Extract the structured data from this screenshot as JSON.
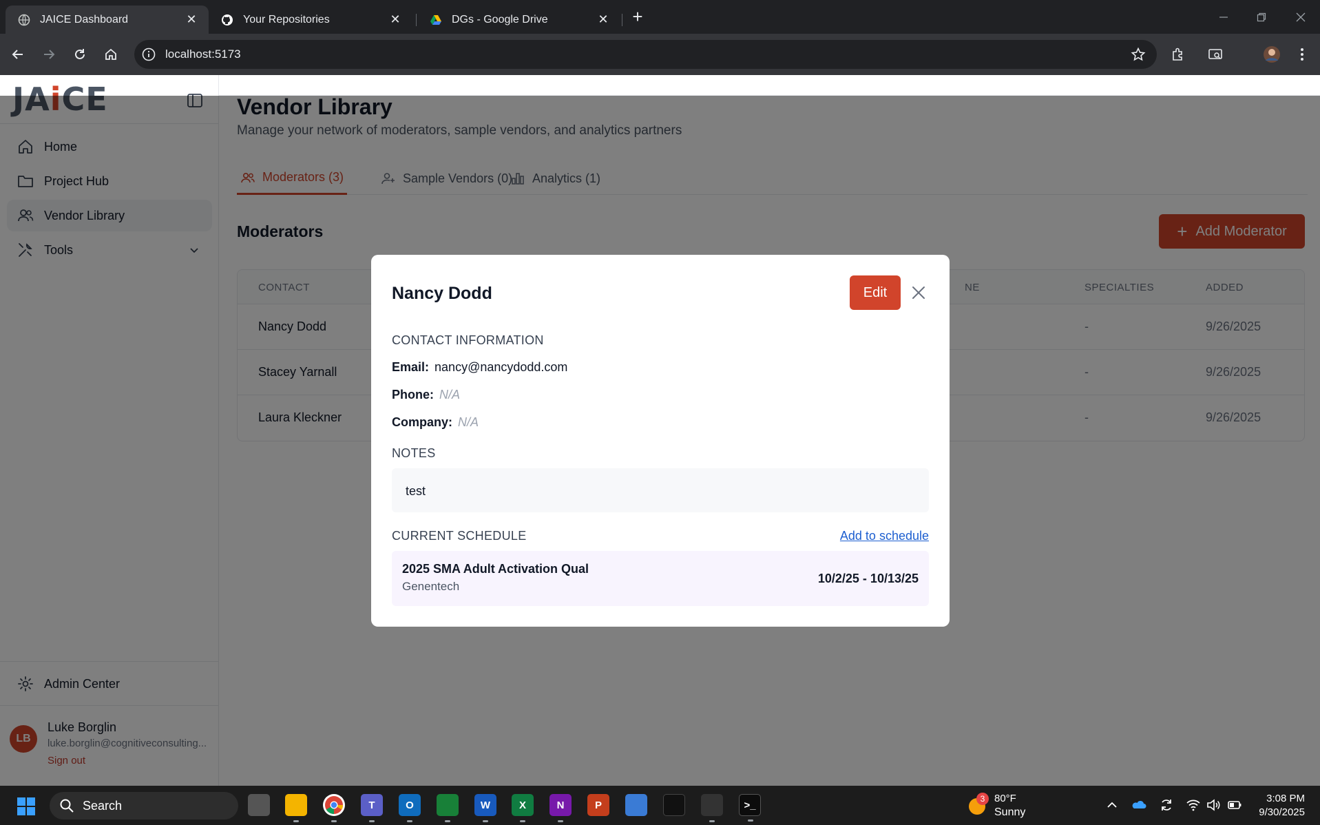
{
  "browser": {
    "tabs": [
      {
        "title": "JAICE Dashboard",
        "favicon": "globe-icon",
        "active": true
      },
      {
        "title": "Your Repositories",
        "favicon": "github-icon",
        "active": false
      },
      {
        "title": "DGs - Google Drive",
        "favicon": "google-drive-icon",
        "active": false
      }
    ],
    "url": "localhost:5173"
  },
  "app": {
    "logo": {
      "pre": "JA",
      "mid": "i",
      "post": "CE"
    },
    "nav": [
      {
        "label": "Home",
        "icon": "home-icon"
      },
      {
        "label": "Project Hub",
        "icon": "folder-icon"
      },
      {
        "label": "Vendor Library",
        "icon": "users-icon",
        "active": true
      },
      {
        "label": "Tools",
        "icon": "tools-icon",
        "expandable": true
      }
    ],
    "admin_label": "Admin Center",
    "user": {
      "initials": "LB",
      "name": "Luke Borglin",
      "email": "luke.borglin@cognitiveconsulting...",
      "signout": "Sign out"
    }
  },
  "page": {
    "title": "Vendor Library",
    "subtitle": "Manage your network of moderators, sample vendors, and analytics partners",
    "tabs": [
      {
        "label": "Moderators (3)",
        "icon": "users-icon",
        "active": true
      },
      {
        "label": "Sample Vendors (0)",
        "icon": "user-plus-icon"
      },
      {
        "label": "Analytics (1)",
        "icon": "bar-chart-icon"
      }
    ],
    "section_title": "Moderators",
    "add_button": "Add Moderator",
    "table": {
      "headers": [
        "CONTACT",
        "NE",
        "SPECIALTIES",
        "ADDED"
      ],
      "rows": [
        {
          "name": "Nancy Dodd",
          "specialties": "-",
          "added": "9/26/2025"
        },
        {
          "name": "Stacey Yarnall",
          "specialties": "-",
          "added": "9/26/2025"
        },
        {
          "name": "Laura Kleckner",
          "specialties": "-",
          "added": "9/26/2025"
        }
      ]
    }
  },
  "modal": {
    "title": "Nancy Dodd",
    "edit_label": "Edit",
    "contact_heading": "CONTACT INFORMATION",
    "email_label": "Email:",
    "email": "nancy@nancydodd.com",
    "phone_label": "Phone:",
    "phone": "N/A",
    "company_label": "Company:",
    "company": "N/A",
    "notes_heading": "NOTES",
    "notes": "test",
    "schedule_heading": "CURRENT SCHEDULE",
    "add_schedule": "Add to schedule",
    "schedule": [
      {
        "project": "2025 SMA Adult Activation Qual",
        "client": "Genentech",
        "dates": "10/2/25 - 10/13/25"
      }
    ]
  },
  "taskbar": {
    "search_placeholder": "Search",
    "weather": {
      "temp": "80°F",
      "condition": "Sunny",
      "badge": "3"
    },
    "time": "3:08 PM",
    "date": "9/30/2025"
  },
  "colors": {
    "accent": "#d1442b",
    "link": "#1d5fd0",
    "schedule_bg": "#f8f4fe"
  }
}
